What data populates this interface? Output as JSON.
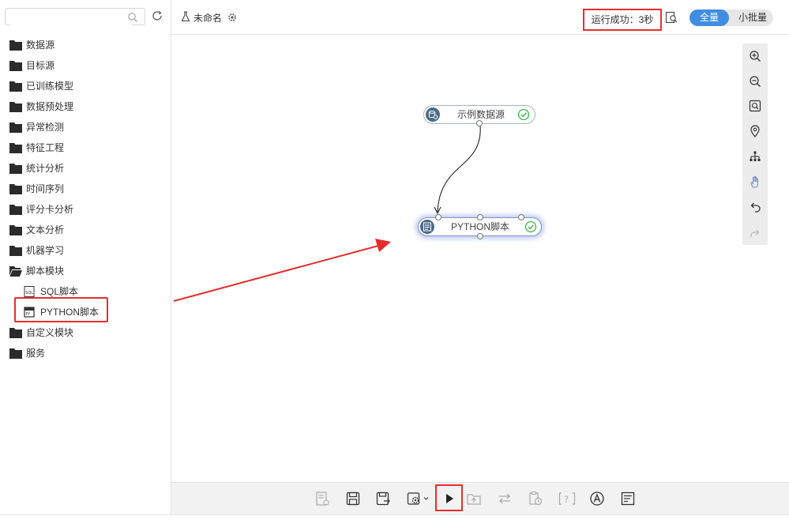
{
  "sidebar": {
    "search": {
      "placeholder": "",
      "value": ""
    },
    "tree": [
      {
        "label": "数据源",
        "type": "folder"
      },
      {
        "label": "目标源",
        "type": "folder"
      },
      {
        "label": "已训练模型",
        "type": "folder"
      },
      {
        "label": "数据预处理",
        "type": "folder"
      },
      {
        "label": "异常检测",
        "type": "folder"
      },
      {
        "label": "特征工程",
        "type": "folder"
      },
      {
        "label": "统计分析",
        "type": "folder"
      },
      {
        "label": "时间序列",
        "type": "folder"
      },
      {
        "label": "评分卡分析",
        "type": "folder"
      },
      {
        "label": "文本分析",
        "type": "folder"
      },
      {
        "label": "机器学习",
        "type": "folder"
      },
      {
        "label": "脚本模块",
        "type": "folder-open"
      },
      {
        "label": "SQL脚本",
        "type": "sql-file"
      },
      {
        "label": "PYTHON脚本",
        "type": "python-file"
      },
      {
        "label": "自定义模块",
        "type": "folder"
      },
      {
        "label": "服务",
        "type": "folder"
      }
    ]
  },
  "topbar": {
    "project_title": "未命名",
    "run_status": "运行成功：3秒",
    "mode_all": "全量",
    "mode_small": "小批量"
  },
  "canvas": {
    "nodes": [
      {
        "id": "source",
        "label": "示例数据源",
        "status": "success"
      },
      {
        "id": "python",
        "label": "PYTHON脚本",
        "status": "success",
        "selected": true
      }
    ]
  },
  "right_toolbar": [
    "zoom-in-icon",
    "zoom-out-icon",
    "fit-view-icon",
    "locate-icon",
    "auto-layout-icon",
    "pan-hand-icon",
    "undo-icon",
    "redo-icon"
  ],
  "bottom_toolbar": [
    "properties-icon",
    "save-icon",
    "save-as-icon",
    "settings-icon",
    "run-icon",
    "export-icon",
    "sync-icon",
    "schedule-icon",
    "help-icon",
    "font-icon",
    "log-icon"
  ],
  "colors": {
    "accent": "#3f8ee2",
    "highlight": "#e62e2e",
    "success": "#3ab54a",
    "node_icon": "#4b6b8a"
  }
}
